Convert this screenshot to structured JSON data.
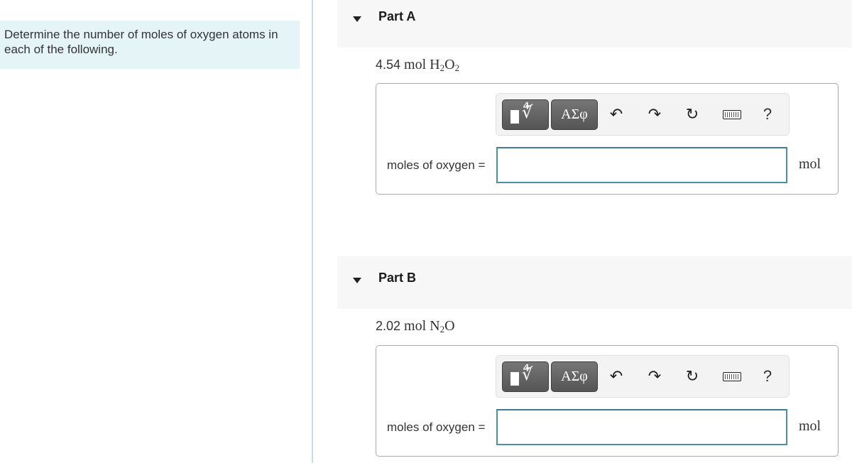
{
  "intro": {
    "text": "Determine the number of moles of oxygen atoms in each of the following."
  },
  "parts": [
    {
      "title": "Part A",
      "question": {
        "amount": "4.54",
        "unit": "mol",
        "formula_parts": [
          [
            "H",
            "2"
          ],
          [
            "O",
            "2"
          ]
        ]
      },
      "toolbar": {
        "templates_icon": "templates-root-icon",
        "greek_label": "ΑΣφ",
        "undo_icon": "undo-icon",
        "redo_icon": "redo-icon",
        "reset_icon": "reset-icon",
        "keyboard_icon": "keyboard-icon",
        "help_label": "?"
      },
      "answer": {
        "label": "moles of oxygen =",
        "value": "",
        "placeholder": "",
        "unit": "mol"
      }
    },
    {
      "title": "Part B",
      "question": {
        "amount": "2.02",
        "unit": "mol",
        "formula_parts": [
          [
            "N",
            "2"
          ],
          [
            "O",
            ""
          ]
        ]
      },
      "toolbar": {
        "templates_icon": "templates-root-icon",
        "greek_label": "ΑΣφ",
        "undo_icon": "undo-icon",
        "redo_icon": "redo-icon",
        "reset_icon": "reset-icon",
        "keyboard_icon": "keyboard-icon",
        "help_label": "?"
      },
      "answer": {
        "label": "moles of oxygen =",
        "value": "",
        "placeholder": "",
        "unit": "mol"
      }
    }
  ],
  "colors": {
    "intro_bg": "#e5f5f7",
    "divider": "#c9d9ea",
    "part_header_bg": "#f7f7f7",
    "input_border": "#4b8ea6"
  }
}
